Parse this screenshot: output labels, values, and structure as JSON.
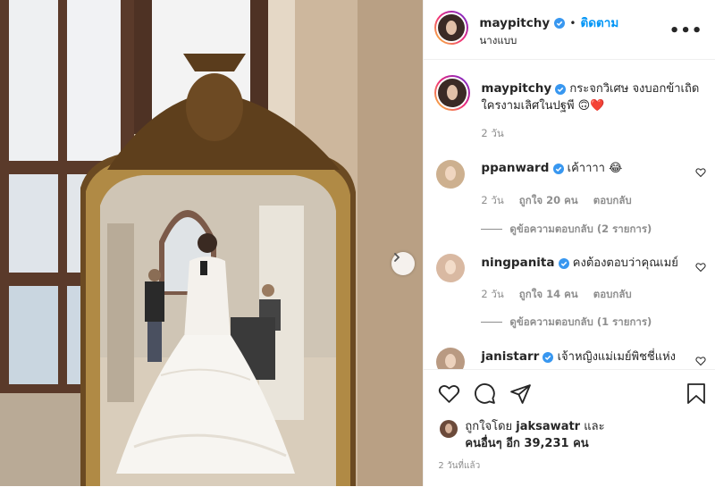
{
  "header": {
    "username": "maypitchy",
    "follow_label": "ติดตาม",
    "separator": "•",
    "subtitle": "นางแบบ",
    "more_icon": "more-horizontal-icon"
  },
  "caption": {
    "username": "maypitchy",
    "text_line1": "กระจกวิเศษ จงบอกข้าเถิด",
    "text_line2": "ใครงามเลิศในปฐพี 🙃❤️",
    "time": "2 วัน"
  },
  "comments": [
    {
      "username": "ppanward",
      "text": "เค้าาาา 😂",
      "time": "2 วัน",
      "likes": "ถูกใจ 20 คน",
      "reply": "ตอบกลับ",
      "view_replies": "ดูข้อความตอบกลับ (2 รายการ)"
    },
    {
      "username": "ningpanita",
      "text": "คงต้องตอบว่าคุณเมย์",
      "time": "2 วัน",
      "likes": "ถูกใจ 14 คน",
      "reply": "ตอบกลับ",
      "view_replies": "ดูข้อความตอบกลับ (1 รายการ)"
    },
    {
      "username": "janistarr",
      "text": "เจ้าหญิงแม่เมย์พิชชี่แห่ง"
    }
  ],
  "likes": {
    "prefix": "ถูกใจโดย",
    "user": "jaksawatr",
    "and": "และ",
    "others": "คนอื่นๆ อีก 39,231 คน"
  },
  "post_time": "2 วันที่แล้ว",
  "icons": [
    "heart-icon",
    "comment-icon",
    "share-icon",
    "bookmark-icon",
    "verified-badge-icon",
    "chevron-right-icon"
  ],
  "colors": {
    "link": "#0095f6",
    "verified": "#3897f0",
    "text": "#262626",
    "muted": "#8e8e8e"
  }
}
